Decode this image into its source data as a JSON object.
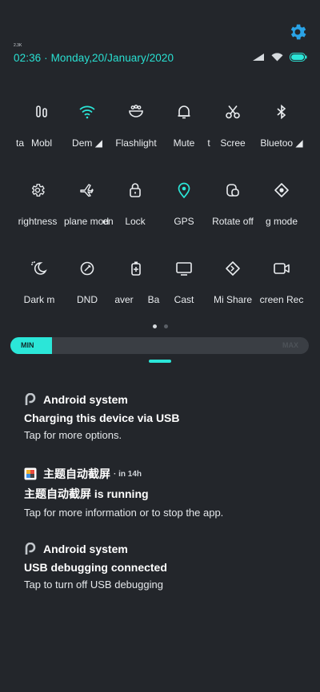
{
  "status": {
    "tiny_label": "2.3K",
    "datetime": "02:36 · Monday,20/January/2020"
  },
  "colors": {
    "accent": "#29e0d2",
    "background": "#23262b"
  },
  "tiles_row1": [
    {
      "label": "ta",
      "icon": "mobile-data-partial-icon"
    },
    {
      "label": "Mobl",
      "icon": "mobile-data-icon"
    },
    {
      "label": "Dem ◢",
      "icon": "wifi-icon"
    },
    {
      "label": "Flashlight",
      "icon": "flashlight-icon"
    },
    {
      "label": "Mute",
      "icon": "bell-icon"
    },
    {
      "label": "t",
      "icon": "screenshot-partial-icon"
    },
    {
      "label": "Scree",
      "icon": "scissors-icon"
    },
    {
      "label": "Bluetoo ◢",
      "icon": "bluetooth-icon"
    }
  ],
  "tiles_row2": [
    {
      "label": "rightness",
      "icon": "gear-icon"
    },
    {
      "label": "plane mod",
      "icon": "airplane-icon"
    },
    {
      "label": "en",
      "icon": "lock-partial-icon"
    },
    {
      "label": "Lock",
      "icon": "lock-icon"
    },
    {
      "label": "GPS",
      "icon": "location-pin-icon"
    },
    {
      "label": "Rotate off",
      "icon": "rotate-lock-icon"
    },
    {
      "label": "g mode",
      "icon": "reading-mode-icon"
    }
  ],
  "tiles_row3": [
    {
      "label": "Dark m",
      "icon": "dark-mode-icon"
    },
    {
      "label": "DND",
      "icon": "dnd-icon"
    },
    {
      "label": "aver",
      "icon": "battery-saver-partial-icon"
    },
    {
      "label": "Ba",
      "icon": "battery-saver-icon"
    },
    {
      "label": "Cast",
      "icon": "cast-icon"
    },
    {
      "label": "Mi Share",
      "icon": "mi-share-icon"
    },
    {
      "label": "creen Rec",
      "icon": "screen-record-icon"
    }
  ],
  "page_indicator": {
    "current": 1,
    "total": 2
  },
  "brightness": {
    "min_label": "MIN",
    "max_label": "MAX",
    "level": 0.14
  },
  "notifications": [
    {
      "app": "Android system",
      "when": "",
      "title": "Charging this device via USB",
      "body": "Tap for more options."
    },
    {
      "app": "主题自动截屏",
      "when": "· in 14h",
      "title": "主题自动截屏 is running",
      "body": "Tap for more information or to stop the app."
    },
    {
      "app": "Android system",
      "when": "",
      "title": "USB debugging connected",
      "body": "Tap to turn off USB debugging"
    }
  ]
}
